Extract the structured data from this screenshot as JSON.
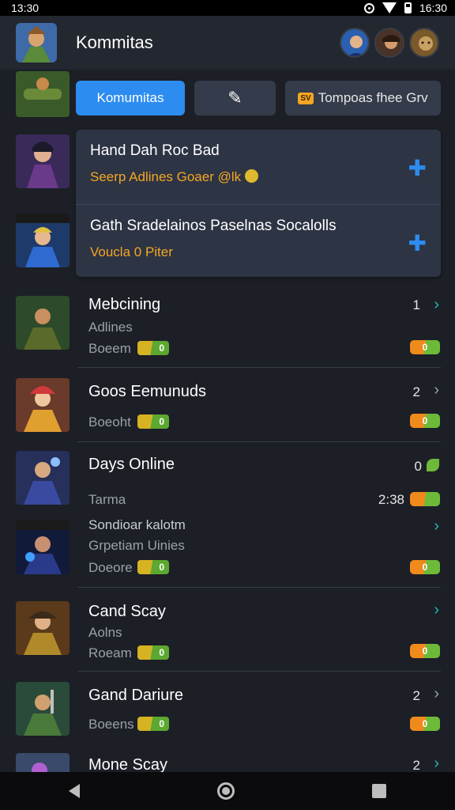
{
  "status": {
    "time": "13:30",
    "clock": "16:30"
  },
  "appbar": {
    "title": "Kommitas"
  },
  "tabs": [
    {
      "label": "Komumitas"
    },
    {
      "label": ""
    },
    {
      "label": "Tompoas fhee Grv",
      "tag": "SV"
    }
  ],
  "featured": [
    {
      "title": "Hand Dah Roc Bad",
      "subtitle": "Seerp Adlines Goaer @lk"
    },
    {
      "title": "Gath Sradelainos Paselnas Socalolls",
      "subtitle": "Voucla 0 Piter"
    }
  ],
  "list": [
    {
      "title": "Mebcining",
      "line1": "Adlines",
      "line2": "Boeem",
      "count": "1",
      "pill": "0",
      "badge": "0"
    },
    {
      "title": "Goos Eemunuds",
      "line1": "Boeoht",
      "count": "2",
      "pill": "0",
      "badge": "0"
    },
    {
      "title": "Days Online",
      "line1": "Tarma",
      "count": "0",
      "time": "2:38"
    },
    {
      "line1": "Sondioar kalotm",
      "line2": "Grpetiam Uinies",
      "line3": "Doeore",
      "pill": "0",
      "badge": "0"
    },
    {
      "title": "Cand Scay",
      "line1": "Aolns",
      "line2": "Roeam",
      "pill": "0",
      "badge": "0"
    },
    {
      "title": "Gand Dariure",
      "line1": "Boeens",
      "count": "2",
      "pill": "0",
      "badge": "0"
    },
    {
      "title": "Mone Scay",
      "count": "2"
    }
  ],
  "colors": {
    "accent": "#2d8cf0",
    "orange": "#f5a623",
    "teal": "#26b5b5"
  }
}
